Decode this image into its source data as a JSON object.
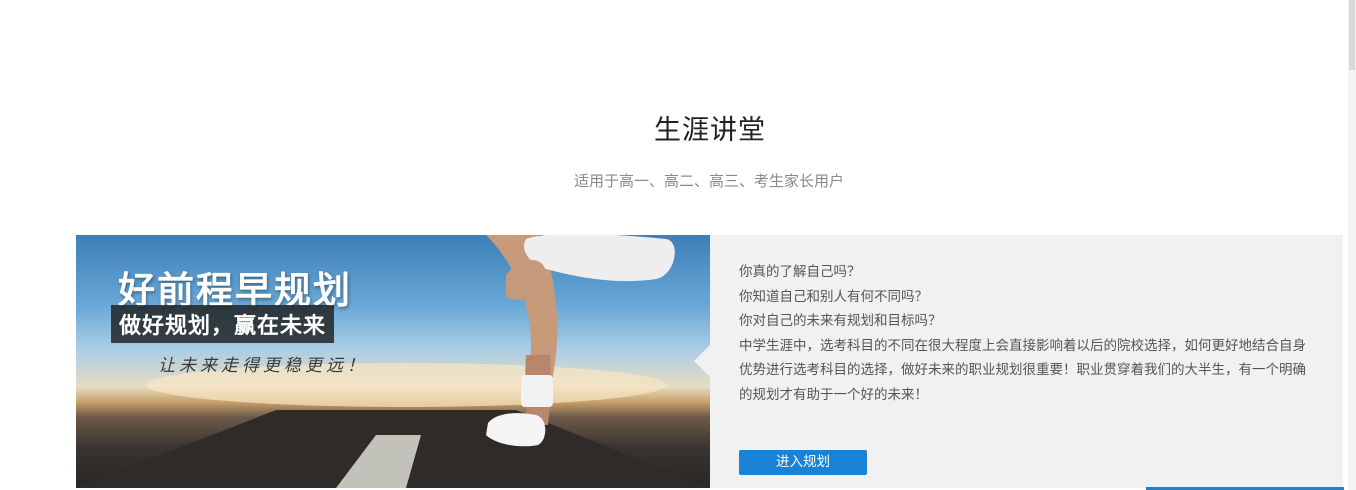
{
  "section": {
    "title": "生涯讲堂",
    "subtitle": "适用于高一、高二、高三、考生家长用户"
  },
  "banner": {
    "headline": "好前程早规划",
    "slogan": "做好规划，赢在未来",
    "tagline": "让未来走得更稳更远！"
  },
  "content": {
    "questions": [
      "你真的了解自己吗？",
      "你知道自己和别人有何不同吗？",
      "你对自己的未来有规划和目标吗？"
    ],
    "paragraph": "中学生涯中，选考科目的不同在很大程度上会直接影响着以后的院校选择，如何更好地结合自身优势进行选考科目的选择，做好未来的职业规划很重要！职业贯穿着我们的大半生，有一个明确的规划才有助于一个好的未来！"
  },
  "cta": {
    "label": "进入规划"
  },
  "colors": {
    "accent": "#1a82d4",
    "card_bg": "#f1f1f1",
    "title": "#222222",
    "subtitle": "#8a8a8a",
    "body_text": "#555555"
  }
}
